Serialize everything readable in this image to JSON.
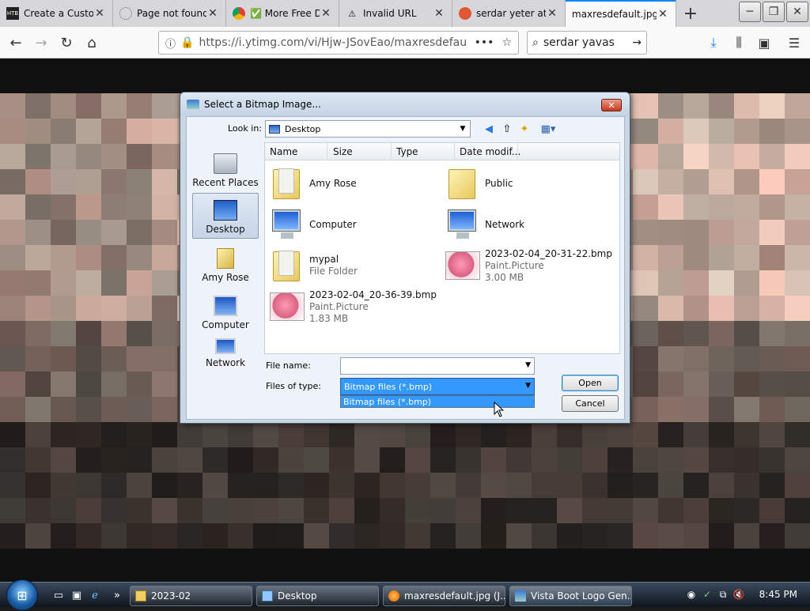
{
  "browser": {
    "tabs": [
      {
        "title": "Create a Custo",
        "icon": "htb-icon"
      },
      {
        "title": "Page not found",
        "icon": "loading-icon"
      },
      {
        "title": "✅ More Free D",
        "icon": "chrome-icon"
      },
      {
        "title": "Invalid URL",
        "icon": "warning-icon"
      },
      {
        "title": "serdar yeter at",
        "icon": "duckduckgo-icon"
      },
      {
        "title": "maxresdefault.jpg (",
        "icon": "image-icon",
        "active": true
      }
    ],
    "url": "https://i.ytimg.com/vi/Hjw-JSovEao/maxresdefault.jpg",
    "search_value": "serdar yavas"
  },
  "dialog": {
    "title": "Select a Bitmap Image...",
    "look_in_label": "Look in:",
    "look_in_value": "Desktop",
    "places": [
      "Recent Places",
      "Desktop",
      "Amy Rose",
      "Computer",
      "Network"
    ],
    "columns": [
      "Name",
      "Size",
      "Type",
      "Date modif..."
    ],
    "items": [
      {
        "name": "Amy Rose",
        "type": "",
        "size": ""
      },
      {
        "name": "Public",
        "type": "",
        "size": ""
      },
      {
        "name": "Computer",
        "type": "",
        "size": ""
      },
      {
        "name": "Network",
        "type": "",
        "size": ""
      },
      {
        "name": "mypal",
        "type": "File Folder",
        "size": ""
      },
      {
        "name": "2023-02-04_20-31-22.bmp",
        "type": "Paint.Picture",
        "size": "3.00 MB"
      },
      {
        "name": "2023-02-04_20-36-39.bmp",
        "type": "Paint.Picture",
        "size": "1.83 MB"
      }
    ],
    "file_name_label": "File name:",
    "file_name_value": "",
    "file_type_label": "Files of type:",
    "file_type_value": "Bitmap files (*.bmp)",
    "file_type_option": "Bitmap files (*.bmp)",
    "open_label": "Open",
    "cancel_label": "Cancel"
  },
  "taskbar": {
    "buttons": [
      "2023-02",
      "Desktop",
      "maxresdefault.jpg (J...",
      "Vista Boot Logo Gen..."
    ],
    "clock": "8:45 PM"
  }
}
